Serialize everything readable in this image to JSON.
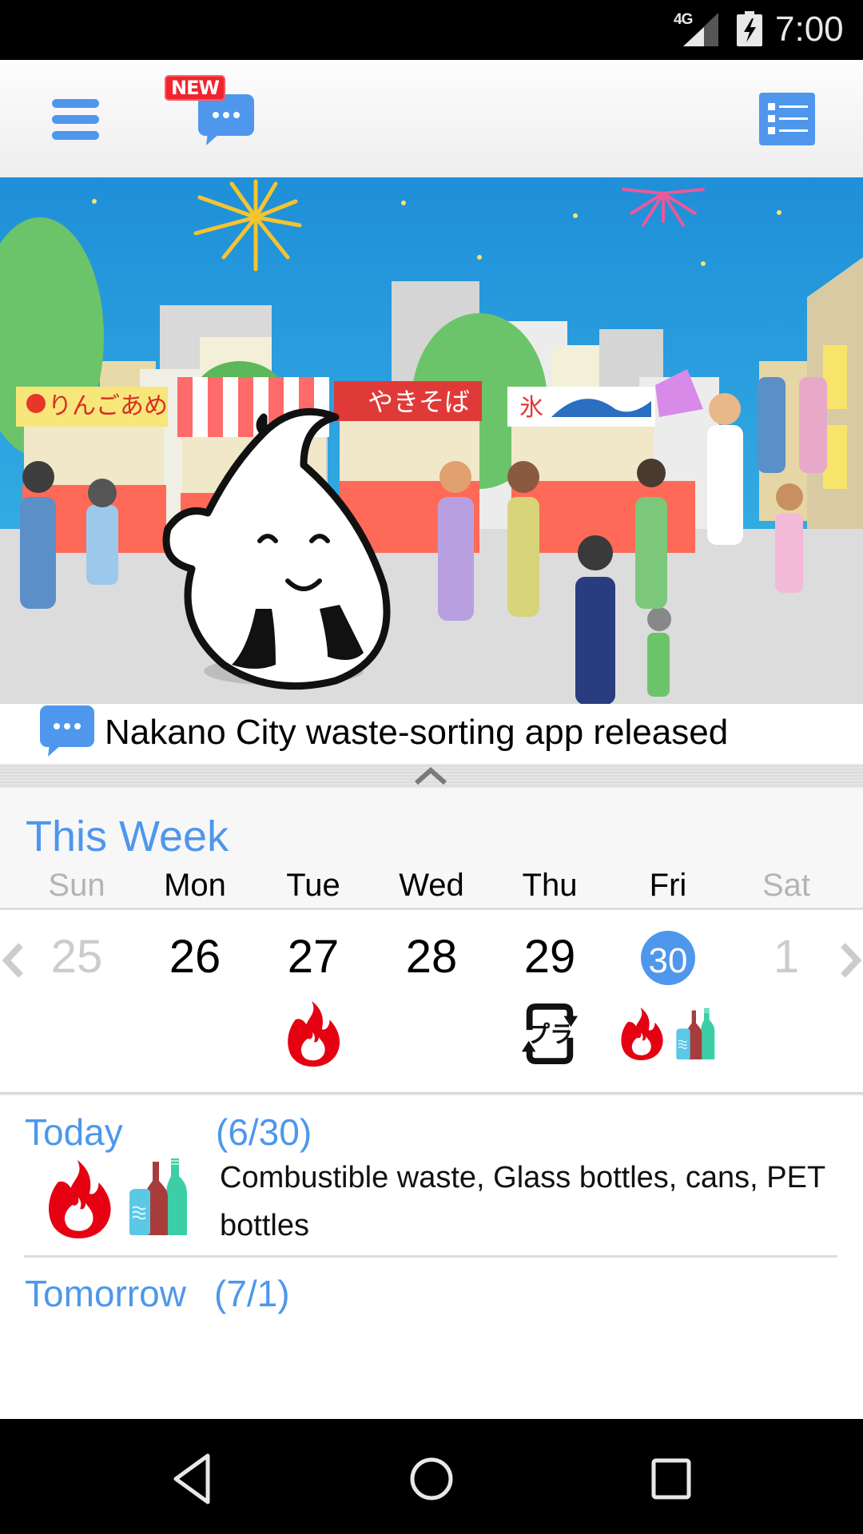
{
  "status_bar": {
    "network": "4G",
    "time": "7:00",
    "icons": [
      "signal-icon",
      "battery-charging-icon"
    ]
  },
  "app_bar": {
    "menu_icon": "hamburger-menu-icon",
    "news_badge": "NEW",
    "news_icon": "chat-bubble-icon",
    "list_icon": "list-icon"
  },
  "banner": {
    "description": "Summer festival illustration with mascot",
    "stall_signs": [
      "りんごあめ",
      "やきそば",
      "氷"
    ]
  },
  "news": {
    "icon": "chat-bubble-icon",
    "headline": "Nakano City waste-sorting app released"
  },
  "week": {
    "title": "This Week",
    "colors": {
      "accent": "#4e97ec",
      "muted": "#b4b4b4",
      "combustible": "#e50012"
    },
    "days": [
      {
        "name": "Sun",
        "date": "25",
        "muted": true,
        "today": false,
        "icons": []
      },
      {
        "name": "Mon",
        "date": "26",
        "muted": false,
        "today": false,
        "icons": []
      },
      {
        "name": "Tue",
        "date": "27",
        "muted": false,
        "today": false,
        "icons": [
          "combustible-fire-icon"
        ]
      },
      {
        "name": "Wed",
        "date": "28",
        "muted": false,
        "today": false,
        "icons": []
      },
      {
        "name": "Thu",
        "date": "29",
        "muted": false,
        "today": false,
        "icons": [
          "plastic-recycle-icon"
        ]
      },
      {
        "name": "Fri",
        "date": "30",
        "muted": false,
        "today": true,
        "icons": [
          "combustible-fire-icon",
          "bottles-cans-icon"
        ]
      },
      {
        "name": "Sat",
        "date": "1",
        "muted": true,
        "today": false,
        "icons": []
      }
    ],
    "plastic_mark_text": "プラ"
  },
  "today": {
    "label": "Today",
    "date": "(6/30)",
    "icons": [
      "combustible-fire-icon",
      "bottles-cans-icon"
    ],
    "description": "Combustible waste, Glass bottles, cans, PET bottles"
  },
  "tomorrow": {
    "label": "Tomorrow",
    "date": "(7/1)"
  },
  "nav_bar": {
    "buttons": [
      "back",
      "home",
      "recents"
    ]
  }
}
